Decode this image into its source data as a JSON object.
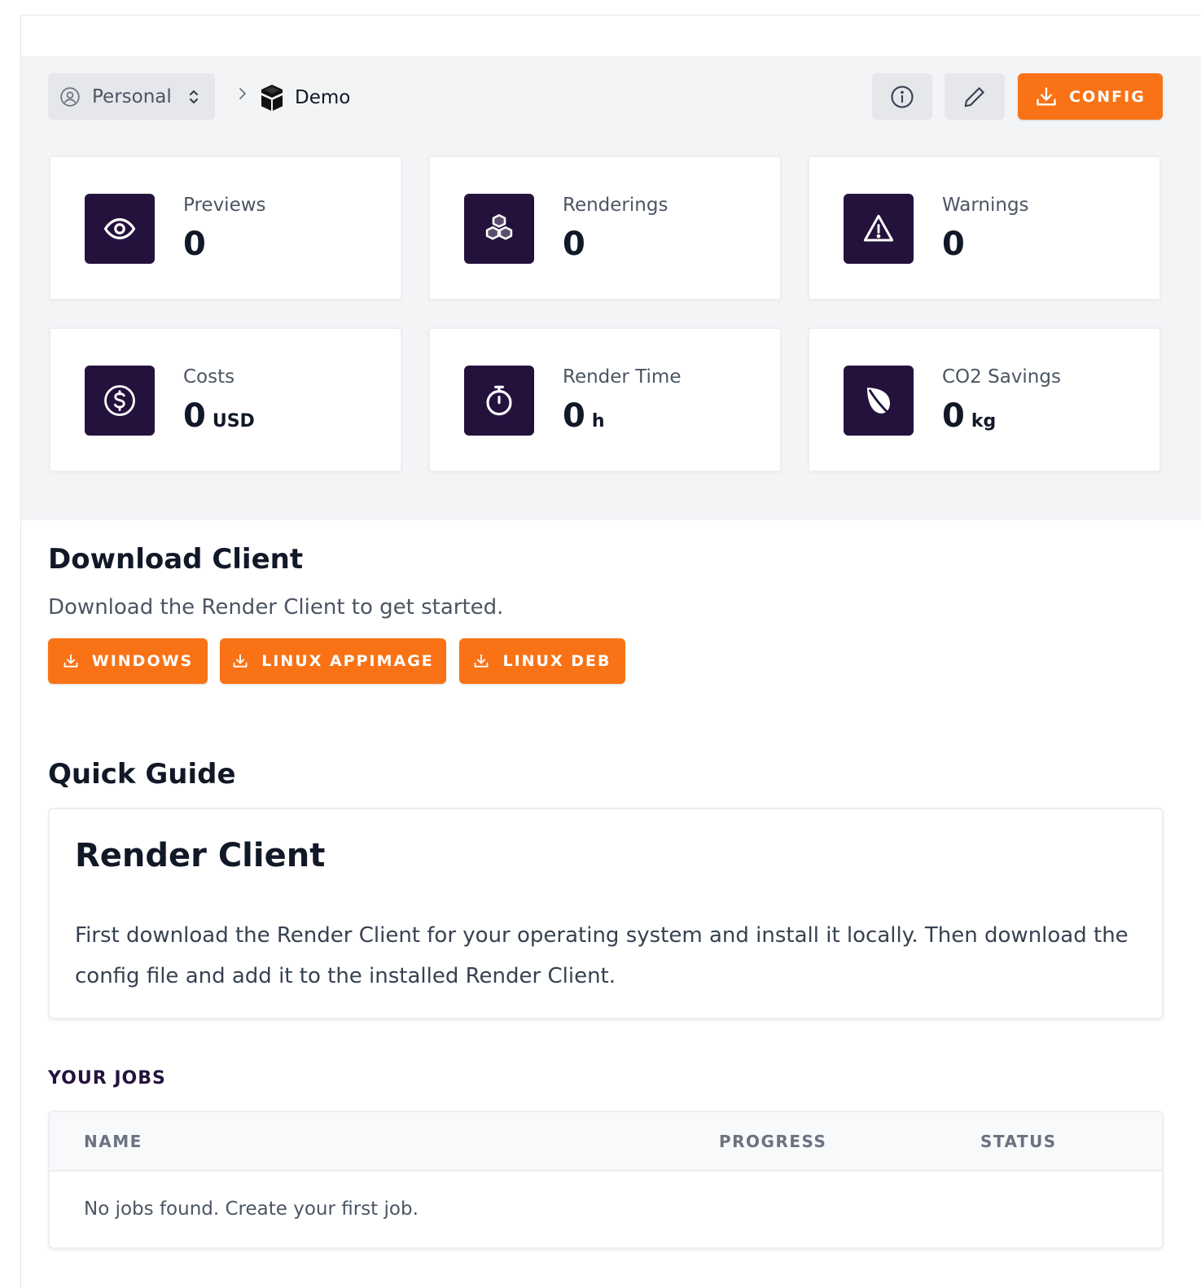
{
  "breadcrumb": {
    "team": "Personal",
    "project": "Demo"
  },
  "toolbar": {
    "config_label": "CONFIG"
  },
  "stats": [
    {
      "label": "Previews",
      "value": "0",
      "unit": "",
      "icon": "eye-icon"
    },
    {
      "label": "Renderings",
      "value": "0",
      "unit": "",
      "icon": "cubes-icon"
    },
    {
      "label": "Warnings",
      "value": "0",
      "unit": "",
      "icon": "warning-triangle-icon"
    },
    {
      "label": "Costs",
      "value": "0",
      "unit": "USD",
      "icon": "dollar-circle-icon"
    },
    {
      "label": "Render Time",
      "value": "0",
      "unit": "h",
      "icon": "stopwatch-icon"
    },
    {
      "label": "CO2 Savings",
      "value": "0",
      "unit": "kg",
      "icon": "leaf-icon"
    }
  ],
  "download": {
    "title": "Download Client",
    "description": "Download the Render Client to get started.",
    "buttons": [
      "WINDOWS",
      "LINUX APPIMAGE",
      "LINUX DEB"
    ]
  },
  "guide": {
    "section_title": "Quick Guide",
    "card_title": "Render Client",
    "text": "First download the Render Client for your operating system and install it locally. Then download the config file and add it to the installed Render Client."
  },
  "jobs": {
    "title": "YOUR JOBS",
    "columns": [
      "NAME",
      "PROGRESS",
      "STATUS"
    ],
    "empty_text": "No jobs found. Create your first job."
  },
  "colors": {
    "accent": "#f97316",
    "tile": "#24123d",
    "header_bg": "#f3f4f6"
  }
}
